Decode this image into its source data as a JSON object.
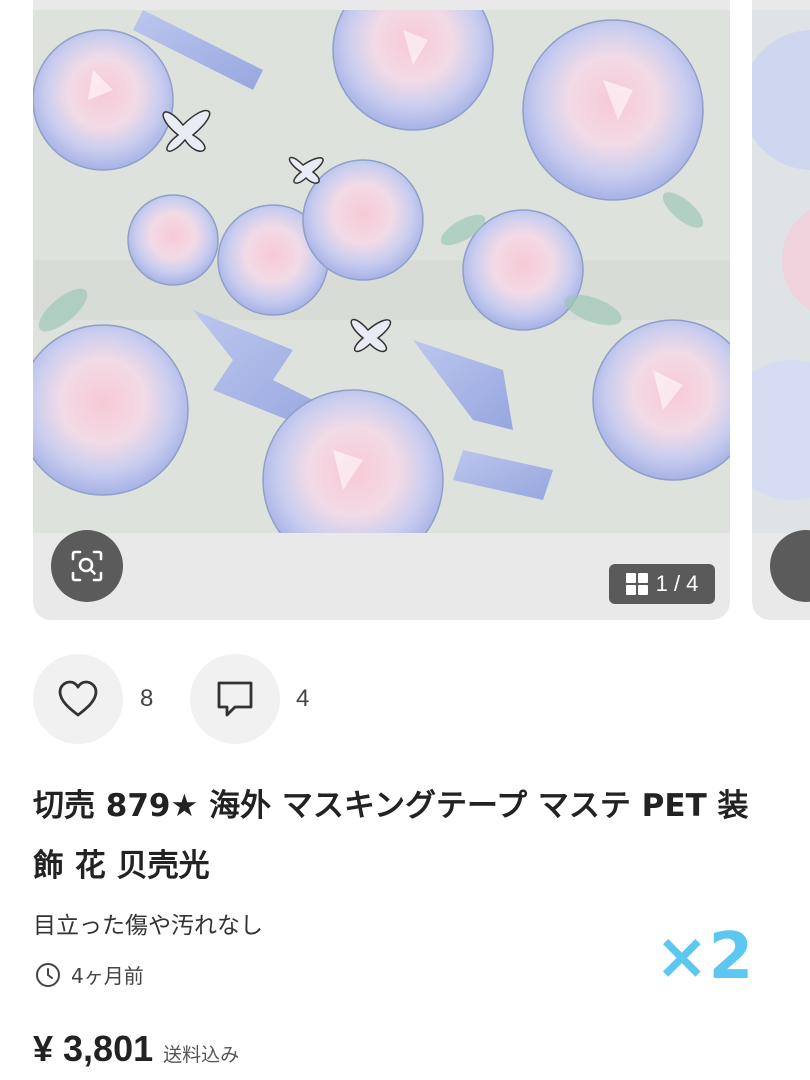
{
  "product": {
    "image_counter": "1 / 4",
    "likes_count": "8",
    "comments_count": "4",
    "title": "切売 879★ 海外 マスキングテープ マステ PET 装飾 花 贝壳光",
    "condition": "目立った傷や汚れなし",
    "posted": "4ヶ月前",
    "price": "¥ 3,801",
    "shipping_note": "送料込み"
  },
  "overlay": {
    "zoom_label": "×2"
  },
  "icons": {
    "lens": "image-search-icon",
    "grid": "grid-icon",
    "like": "heart-icon",
    "comment": "comment-icon",
    "time": "clock-icon"
  },
  "colors": {
    "accent": "#5cc8f2",
    "card_bg": "#e9e9e9",
    "button_bg": "#f1f1f1",
    "dark_overlay": "#5a5a5a"
  }
}
